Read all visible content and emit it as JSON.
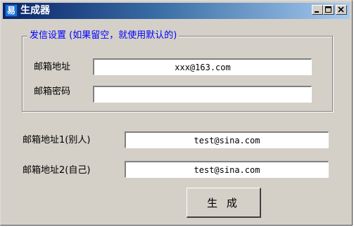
{
  "window": {
    "title": "生成器",
    "icon": "app-icon",
    "icon_glyph": "易",
    "minimize_icon": "minimize-icon",
    "maximize_icon": "maximize-icon",
    "close_icon": "close-icon"
  },
  "sender_group": {
    "legend": "发信设置 (如果留空，就使用默认的)",
    "email_label": "邮箱地址",
    "email_value": "xxx@163.com",
    "password_label": "邮箱密码",
    "password_value": ""
  },
  "recipients": {
    "address1_label": "邮箱地址1(别人)",
    "address1_value": "test@sina.com",
    "address2_label": "邮箱地址2(自己)",
    "address2_value": "test@sina.com"
  },
  "generate_button": "生 成",
  "colors": {
    "title_bar_start": "#0a246a",
    "title_bar_end": "#a6caf0",
    "legend_text": "#0000ff",
    "window_face": "#d4d0c8"
  }
}
